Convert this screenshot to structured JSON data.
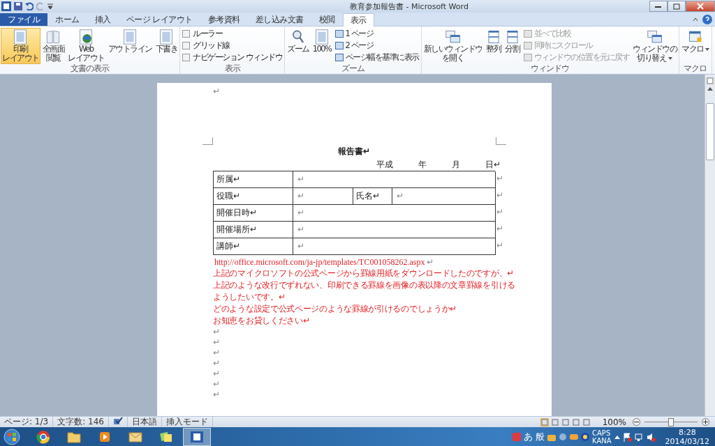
{
  "title_bar": {
    "title": "教育参加報告書 - Microsoft Word"
  },
  "tabs": [
    {
      "label": "ファイル",
      "kind": "file",
      "selected": false
    },
    {
      "label": "ホーム",
      "kind": "tab",
      "selected": false
    },
    {
      "label": "挿入",
      "kind": "tab",
      "selected": false
    },
    {
      "label": "ページ レイアウト",
      "kind": "tab",
      "selected": false
    },
    {
      "label": "参考資料",
      "kind": "tab",
      "selected": false
    },
    {
      "label": "差し込み文書",
      "kind": "tab",
      "selected": false
    },
    {
      "label": "校閲",
      "kind": "tab",
      "selected": false
    },
    {
      "label": "表示",
      "kind": "tab",
      "selected": true
    }
  ],
  "ribbon_groups": [
    {
      "label": "文書の表示",
      "items": [
        {
          "kind": "large",
          "lines": [
            "印刷",
            "レイアウト"
          ],
          "selected": true
        },
        {
          "kind": "large",
          "lines": [
            "全画面",
            "閲覧"
          ],
          "selected": false
        },
        {
          "kind": "large",
          "lines": [
            "Web",
            "レイアウト"
          ],
          "selected": false
        },
        {
          "kind": "large",
          "lines": [
            "アウトライン"
          ],
          "selected": false
        },
        {
          "kind": "large",
          "lines": [
            "下書き"
          ],
          "selected": false
        }
      ]
    },
    {
      "label": "表示",
      "items": [
        {
          "kind": "check",
          "label": "ルーラー",
          "checked": false
        },
        {
          "kind": "check",
          "label": "グリッド線",
          "checked": false
        },
        {
          "kind": "check",
          "label": "ナビゲーション ウィンドウ",
          "checked": false
        }
      ]
    },
    {
      "label": "ズーム",
      "items": [
        {
          "kind": "large",
          "lines": [
            "ズーム"
          ]
        },
        {
          "kind": "large",
          "lines": [
            "100%"
          ]
        },
        {
          "kind": "small",
          "label": "1 ページ",
          "disabled": false
        },
        {
          "kind": "small",
          "label": "2 ページ",
          "disabled": false
        },
        {
          "kind": "small",
          "label": "ページ幅を基準に表示",
          "disabled": false
        }
      ]
    },
    {
      "label": "ウィンドウ",
      "items": [
        {
          "kind": "large",
          "lines": [
            "新しいウィンドウ",
            "を開く"
          ]
        },
        {
          "kind": "large",
          "lines": [
            "整列"
          ]
        },
        {
          "kind": "large",
          "lines": [
            "分割"
          ]
        },
        {
          "kind": "small",
          "label": "並べて比較",
          "disabled": true
        },
        {
          "kind": "small",
          "label": "同時にスクロール",
          "disabled": true
        },
        {
          "kind": "small",
          "label": "ウィンドウの位置を元に戻す",
          "disabled": true
        },
        {
          "kind": "large",
          "lines": [
            "ウィンドウの",
            "切り替え"
          ],
          "dropdown": true
        }
      ]
    },
    {
      "label": "マクロ",
      "items": [
        {
          "kind": "large",
          "lines": [
            "マクロ"
          ],
          "dropdown": true
        }
      ]
    }
  ],
  "document": {
    "top_mark": "↵",
    "heading": "報告書↵",
    "date_line": "平成　　　年　　　月　　　日↵",
    "table": {
      "rows": [
        {
          "cells": [
            "所属↵",
            "↵"
          ],
          "end_mark": "↵"
        },
        {
          "cells": [
            "役職↵",
            "↵",
            "氏名↵",
            "↵"
          ],
          "end_mark": "↵"
        },
        {
          "cells": [
            "開催日時↵",
            "↵"
          ],
          "end_mark": "↵"
        },
        {
          "cells": [
            "開催場所↵",
            "↵"
          ],
          "end_mark": "↵"
        },
        {
          "cells": [
            "講師↵",
            "↵"
          ],
          "end_mark": "↵"
        }
      ]
    },
    "link": "http://office.microsoft.com/ja-jp/templates/TC001058262.aspx",
    "link_mark": "↵",
    "paragraphs": [
      "上記のマイクロソフトの公式ページから罫線用紙をダウンロードしたのですが、↵",
      "上記のような改行でずれない、印刷できる罫線を画像の表以降の文章罫線を引けるようしたいです。↵",
      "どのような設定で公式ページのような罫線が引けるのでしょうか↵",
      "お知恵をお貸しください↵"
    ],
    "empty_lines": [
      "↵",
      "↵",
      "↵",
      "↵",
      "↵",
      "↵",
      "↵"
    ]
  },
  "status_bar": {
    "page": "ページ: 1/3",
    "words": "文字数: 146",
    "language": "日本語",
    "mode": "挿入モード",
    "view_buttons": [
      {
        "selected": true
      },
      {
        "selected": false
      },
      {
        "selected": false
      },
      {
        "selected": false
      },
      {
        "selected": false
      }
    ],
    "zoom": "100%",
    "zoom_slider": {
      "level": 0.5
    }
  },
  "taskbar": {
    "apps": [
      {
        "selected": false
      },
      {
        "selected": false
      },
      {
        "selected": false
      },
      {
        "selected": false
      },
      {
        "selected": false
      },
      {
        "selected": true
      }
    ],
    "ime": "あ",
    "ime_mode": "般",
    "caps": "CAPS",
    "kana": "KANA",
    "time": "8:28",
    "date": "2014/03/12"
  }
}
